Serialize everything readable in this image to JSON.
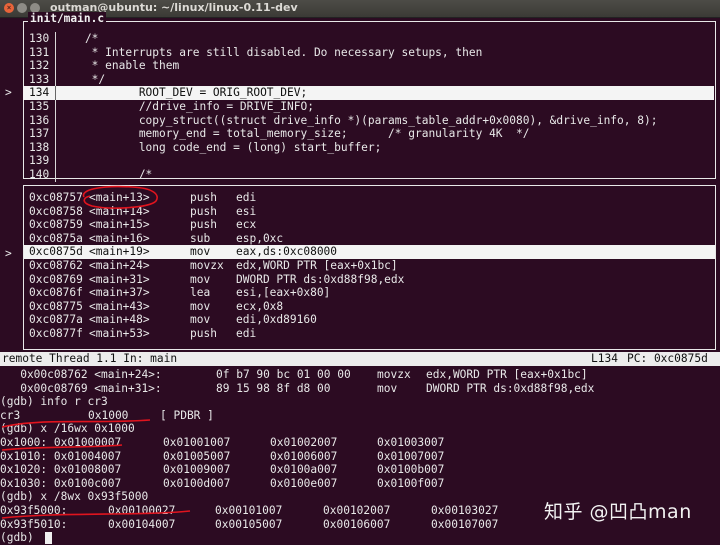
{
  "window": {
    "title": "outman@ubuntu: ~/linux/linux-0.11-dev"
  },
  "source": {
    "filename": "init/main.c",
    "current_marker": ">",
    "lines": [
      {
        "num": "130",
        "text": "    /*"
      },
      {
        "num": "131",
        "text": "     * Interrupts are still disabled. Do necessary setups, then"
      },
      {
        "num": "132",
        "text": "     * enable them"
      },
      {
        "num": "133",
        "text": "     */"
      },
      {
        "num": "134",
        "text": "            ROOT_DEV = ORIG_ROOT_DEV;"
      },
      {
        "num": "135",
        "text": "            //drive_info = DRIVE_INFO;"
      },
      {
        "num": "136",
        "text": "            copy_struct((struct drive_info *)(params_table_addr+0x0080), &drive_info, 8);"
      },
      {
        "num": "137",
        "text": "            memory_end = total_memory_size;      /* granularity 4K  */"
      },
      {
        "num": "138",
        "text": "            long code_end = (long) start_buffer;"
      },
      {
        "num": "139",
        "text": ""
      },
      {
        "num": "140",
        "text": "            /*"
      }
    ],
    "highlight_index": 4
  },
  "asm": {
    "current_marker": ">",
    "highlight_index": 4,
    "rows": [
      {
        "addr": "0xc08757",
        "sym": "<main+13>",
        "op": "push",
        "args": "edi"
      },
      {
        "addr": "0xc08758",
        "sym": "<main+14>",
        "op": "push",
        "args": "esi"
      },
      {
        "addr": "0xc08759",
        "sym": "<main+15>",
        "op": "push",
        "args": "ecx"
      },
      {
        "addr": "0xc0875a",
        "sym": "<main+16>",
        "op": "sub",
        "args": "esp,0xc"
      },
      {
        "addr": "0xc0875d",
        "sym": "<main+19>",
        "op": "mov",
        "args": "eax,ds:0xc08000"
      },
      {
        "addr": "0xc08762",
        "sym": "<main+24>",
        "op": "movzx",
        "args": "edx,WORD PTR [eax+0x1bc]"
      },
      {
        "addr": "0xc08769",
        "sym": "<main+31>",
        "op": "mov",
        "args": "DWORD PTR ds:0xd88f98,edx"
      },
      {
        "addr": "0xc0876f",
        "sym": "<main+37>",
        "op": "lea",
        "args": "esi,[eax+0x80]"
      },
      {
        "addr": "0xc08775",
        "sym": "<main+43>",
        "op": "mov",
        "args": "ecx,0x8"
      },
      {
        "addr": "0xc0877a",
        "sym": "<main+48>",
        "op": "mov",
        "args": "edi,0xd89160"
      },
      {
        "addr": "0xc0877f",
        "sym": "<main+53>",
        "op": "push",
        "args": "edi"
      }
    ]
  },
  "status": {
    "left": "remote Thread 1.1 In: main",
    "line": "L134",
    "pc": "PC: 0xc0875d"
  },
  "command": {
    "rows": [
      {
        "cells": [
          "   0x00c08762 <main+24>:",
          "0f b7 90 bc 01 00 00",
          "movzx",
          "edx,WORD PTR [eax+0x1bc]"
        ]
      },
      {
        "cells": [
          "   0x00c08769 <main+31>:",
          "89 15 98 8f d8 00",
          "mov",
          "DWORD PTR ds:0xd88f98,edx"
        ]
      },
      {
        "cells": [
          "(gdb) info r cr3"
        ]
      },
      {
        "cells": [
          "cr3",
          "0x1000",
          "[ PDBR ]"
        ]
      },
      {
        "cells": [
          "(gdb) x /16wx 0x1000"
        ]
      },
      {
        "cells": [
          "0x1000: 0x01000007",
          "0x01001007",
          "0x01002007",
          "0x01003007"
        ]
      },
      {
        "cells": [
          "0x1010: 0x01004007",
          "0x01005007",
          "0x01006007",
          "0x01007007"
        ]
      },
      {
        "cells": [
          "0x1020: 0x01008007",
          "0x01009007",
          "0x0100a007",
          "0x0100b007"
        ]
      },
      {
        "cells": [
          "0x1030: 0x0100c007",
          "0x0100d007",
          "0x0100e007",
          "0x0100f007"
        ]
      },
      {
        "cells": [
          "(gdb) x /8wx 0x93f5000"
        ]
      },
      {
        "cells": [
          "0x93f5000:",
          "0x00100027",
          "0x00101007",
          "0x00102007",
          "0x00103027"
        ]
      },
      {
        "cells": [
          "0x93f5010:",
          "0x00104007",
          "0x00105007",
          "0x00106007",
          "0x00107007"
        ]
      },
      {
        "cells": [
          "(gdb) "
        ]
      }
    ]
  },
  "watermark": "知乎 @凹凸man",
  "colors": {
    "background": "#2c0b22",
    "text": "#e8e8e8",
    "annotation": "#e0141e"
  }
}
